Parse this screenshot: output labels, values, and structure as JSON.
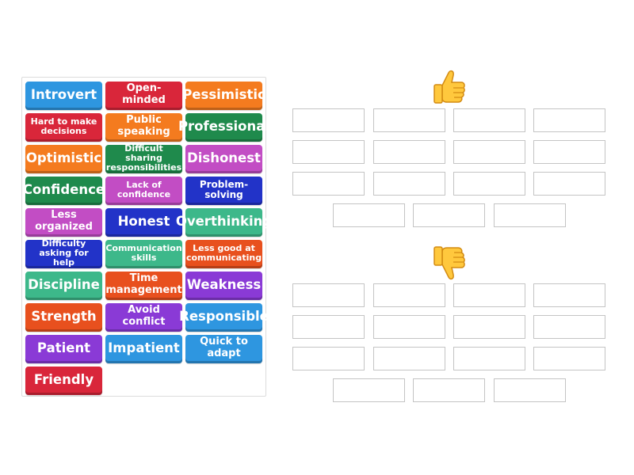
{
  "tiles": [
    {
      "label": "Introvert",
      "color": "#2e96e0"
    },
    {
      "label": "Open-minded",
      "color": "#d9263a"
    },
    {
      "label": "Pessimistic",
      "color": "#f47b1f"
    },
    {
      "label": "Hard to make decisions",
      "color": "#d9263a"
    },
    {
      "label": "Public speaking",
      "color": "#f47b1f"
    },
    {
      "label": "Professional",
      "color": "#1f8a4c"
    },
    {
      "label": "Optimistic",
      "color": "#f47b1f"
    },
    {
      "label": "Difficult sharing responsibilities",
      "color": "#1f8a4c"
    },
    {
      "label": "Dishonest",
      "color": "#c24dc4"
    },
    {
      "label": "Confidence",
      "color": "#1f8a4c"
    },
    {
      "label": "Lack of confidence",
      "color": "#c24dc4"
    },
    {
      "label": "Problem-solving",
      "color": "#2233c8"
    },
    {
      "label": "Less organized",
      "color": "#c24dc4"
    },
    {
      "label": "Honest",
      "color": "#2233c8"
    },
    {
      "label": "Overthinking",
      "color": "#3db88a"
    },
    {
      "label": "Difficulty asking for help",
      "color": "#2233c8"
    },
    {
      "label": "Communication skills",
      "color": "#3db88a"
    },
    {
      "label": "Less good at communicating",
      "color": "#e8501e"
    },
    {
      "label": "Discipline",
      "color": "#3db88a"
    },
    {
      "label": "Time management",
      "color": "#e8501e"
    },
    {
      "label": "Weakness",
      "color": "#8a3ad6"
    },
    {
      "label": "Strength",
      "color": "#e8501e"
    },
    {
      "label": "Avoid conflict",
      "color": "#8a3ad6"
    },
    {
      "label": "Responsible",
      "color": "#2e96e0"
    },
    {
      "label": "Patient",
      "color": "#8a3ad6"
    },
    {
      "label": "Impatient",
      "color": "#2e96e0"
    },
    {
      "label": "Quick to adapt",
      "color": "#2e96e0"
    },
    {
      "label": "Friendly",
      "color": "#d9263a"
    }
  ],
  "groups": [
    {
      "icon": "thumbs-up-icon",
      "slot_count": 15
    },
    {
      "icon": "thumbs-down-icon",
      "slot_count": 15
    }
  ],
  "colors": {
    "thumb_fill": "#ffc83d",
    "thumb_dark": "#d38b12",
    "slot_border": "#c4c4c4"
  }
}
